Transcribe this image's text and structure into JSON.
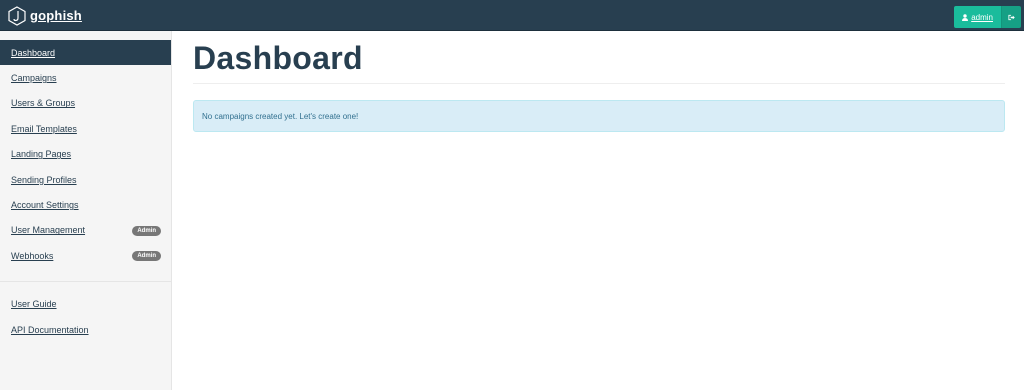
{
  "navbar": {
    "brand": "gophish",
    "user_label": "admin",
    "user_icon": "user-icon",
    "logout_icon": "sign-out-icon",
    "accent": "#1abc9c",
    "background": "#283f50"
  },
  "sidebar": {
    "items": [
      {
        "label": "Dashboard",
        "active": true
      },
      {
        "label": "Campaigns"
      },
      {
        "label": "Users & Groups"
      },
      {
        "label": "Email Templates"
      },
      {
        "label": "Landing Pages"
      },
      {
        "label": "Sending Profiles"
      },
      {
        "label": "Account Settings"
      },
      {
        "label": "User Management",
        "badge": "Admin"
      },
      {
        "label": "Webhooks",
        "badge": "Admin"
      }
    ],
    "secondary": [
      {
        "label": "User Guide"
      },
      {
        "label": "API Documentation"
      }
    ]
  },
  "main": {
    "title": "Dashboard",
    "alert": "No campaigns created yet. Let's create one!",
    "alert_color": "#31708f"
  }
}
